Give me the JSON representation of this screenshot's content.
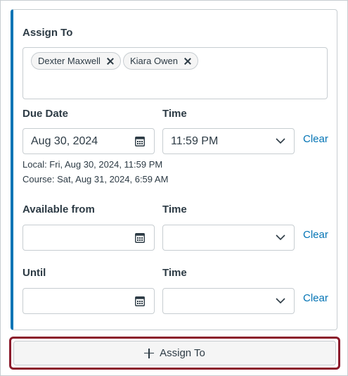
{
  "assign_to": {
    "label": "Assign To",
    "chips": [
      {
        "name": "Dexter Maxwell"
      },
      {
        "name": "Kiara Owen"
      }
    ]
  },
  "due": {
    "date_label": "Due Date",
    "time_label": "Time",
    "date_value": "Aug 30, 2024",
    "time_value": "11:59 PM",
    "clear_label": "Clear",
    "local_note": "Local: Fri, Aug 30, 2024, 11:59 PM",
    "course_note": "Course: Sat, Aug 31, 2024, 6:59 AM"
  },
  "available": {
    "date_label": "Available from",
    "time_label": "Time",
    "date_value": "",
    "time_value": "",
    "clear_label": "Clear"
  },
  "until": {
    "date_label": "Until",
    "time_label": "Time",
    "date_value": "",
    "time_value": "",
    "clear_label": "Clear"
  },
  "add_button": {
    "label": "Assign To"
  },
  "colors": {
    "accent": "#0374b5",
    "focus_ring": "#8b1a2b"
  }
}
